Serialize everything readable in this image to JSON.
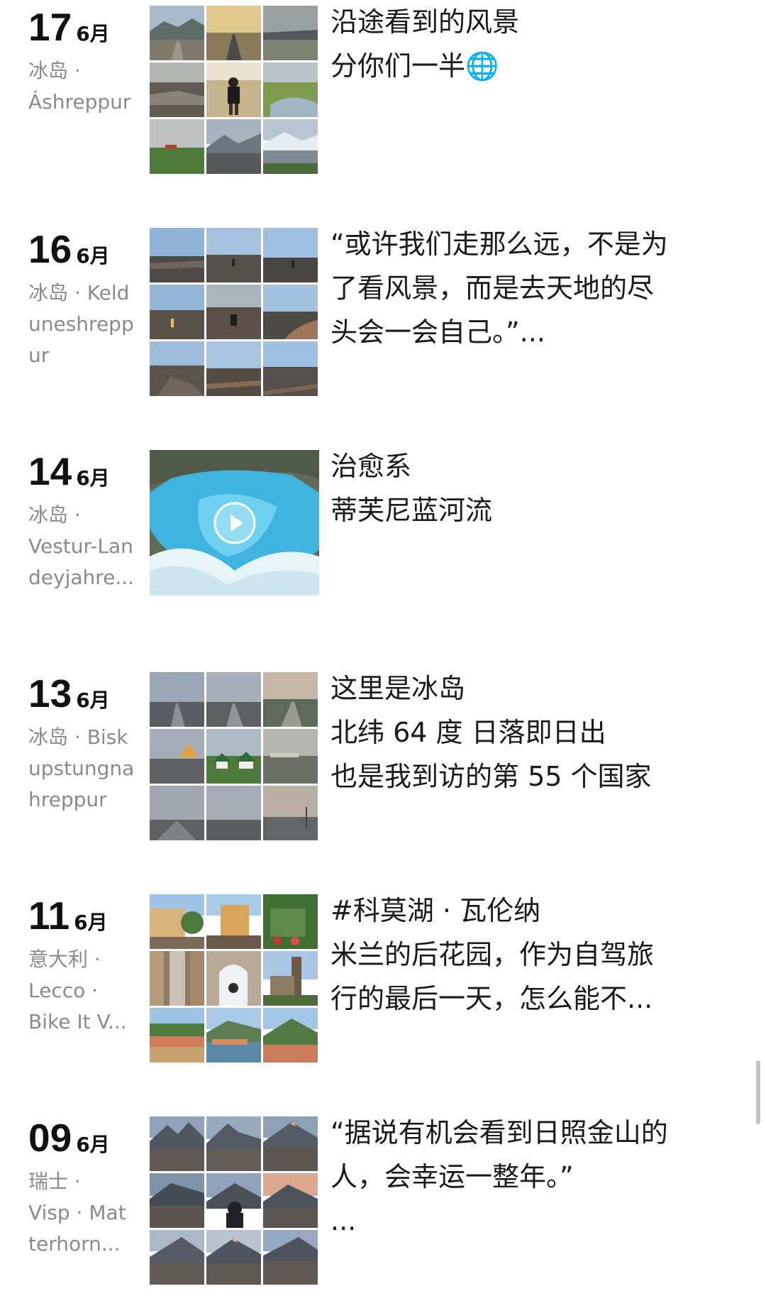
{
  "posts": [
    {
      "day": "17",
      "month": "6月",
      "location_lines": [
        "冰岛 ·",
        "Áshreppur"
      ],
      "text_lines": [
        "沿途看到的风景",
        "分你们一半🌐"
      ],
      "media": "grid9"
    },
    {
      "day": "16",
      "month": "6月",
      "location_lines": [
        "冰岛 · Keld",
        "uneshrepp",
        "ur"
      ],
      "text_lines": [
        "“或许我们走那么远，不是为",
        "了看风景，而是去天地的尽",
        "头会一会自己。”..."
      ],
      "media": "grid9"
    },
    {
      "day": "14",
      "month": "6月",
      "location_lines": [
        "冰岛 ·",
        "Vestur-Lan",
        "deyjahre..."
      ],
      "text_lines": [
        "治愈系",
        "蒂芙尼蓝河流"
      ],
      "media": "video"
    },
    {
      "day": "13",
      "month": "6月",
      "location_lines": [
        "冰岛 · Bisk",
        "upstungna",
        "hreppur"
      ],
      "text_lines": [
        "这里是冰岛",
        "北纬 64 度 日落即日出",
        "也是我到访的第 55 个国家"
      ],
      "media": "grid9"
    },
    {
      "day": "11",
      "month": "6月",
      "location_lines": [
        "意大利 ·",
        "Lecco ·",
        "Bike It V..."
      ],
      "text_lines": [
        "#科莫湖 · 瓦伦纳",
        "米兰的后花园，作为自驾旅",
        "行的最后一天，怎么能不..."
      ],
      "media": "grid9"
    },
    {
      "day": "09",
      "month": "6月",
      "location_lines": [
        "瑞士 ·",
        "Visp · Mat",
        "terhorn..."
      ],
      "text_lines": [
        "“据说有机会看到日照金山的",
        "人，会幸运一整年。”",
        "..."
      ],
      "media": "grid9"
    }
  ],
  "colors": {
    "text_primary": "#1a1a1a",
    "text_secondary": "#8a8a8a",
    "background": "#ffffff",
    "river_blue": "#3bb8e0"
  },
  "icons": {
    "play": "play-icon"
  }
}
